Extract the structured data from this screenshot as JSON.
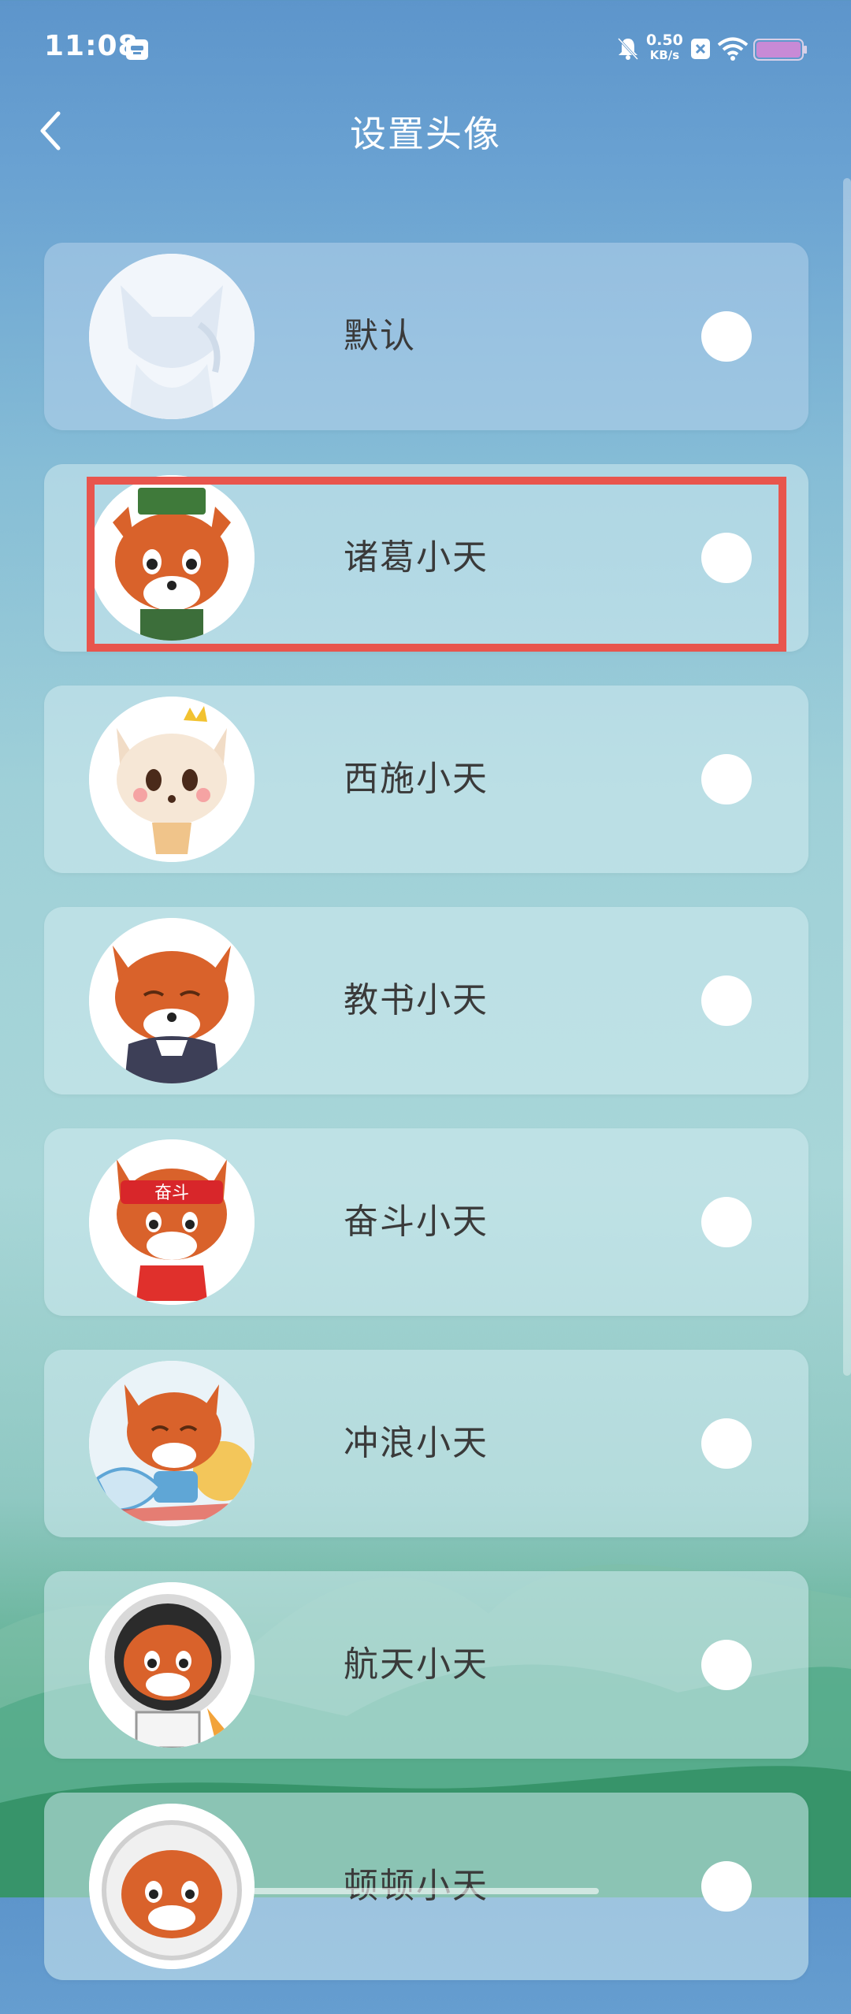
{
  "status_bar": {
    "time": "11:08",
    "net_speed_value": "0.50",
    "net_speed_unit": "KB/s"
  },
  "header": {
    "title": "设置头像",
    "back_icon": "chevron-left-icon"
  },
  "avatars": [
    {
      "label": "默认",
      "selected": false
    },
    {
      "label": "诸葛小天",
      "selected": false
    },
    {
      "label": "西施小天",
      "selected": false
    },
    {
      "label": "教书小天",
      "selected": false
    },
    {
      "label": "奋斗小天",
      "selected": false
    },
    {
      "label": "冲浪小天",
      "selected": false
    },
    {
      "label": "航天小天",
      "selected": false
    },
    {
      "label": "顿顿小天",
      "selected": false
    }
  ],
  "headband_text": "奋斗",
  "colors": {
    "highlight": "#e8554d",
    "fox_orange": "#d9622b"
  }
}
